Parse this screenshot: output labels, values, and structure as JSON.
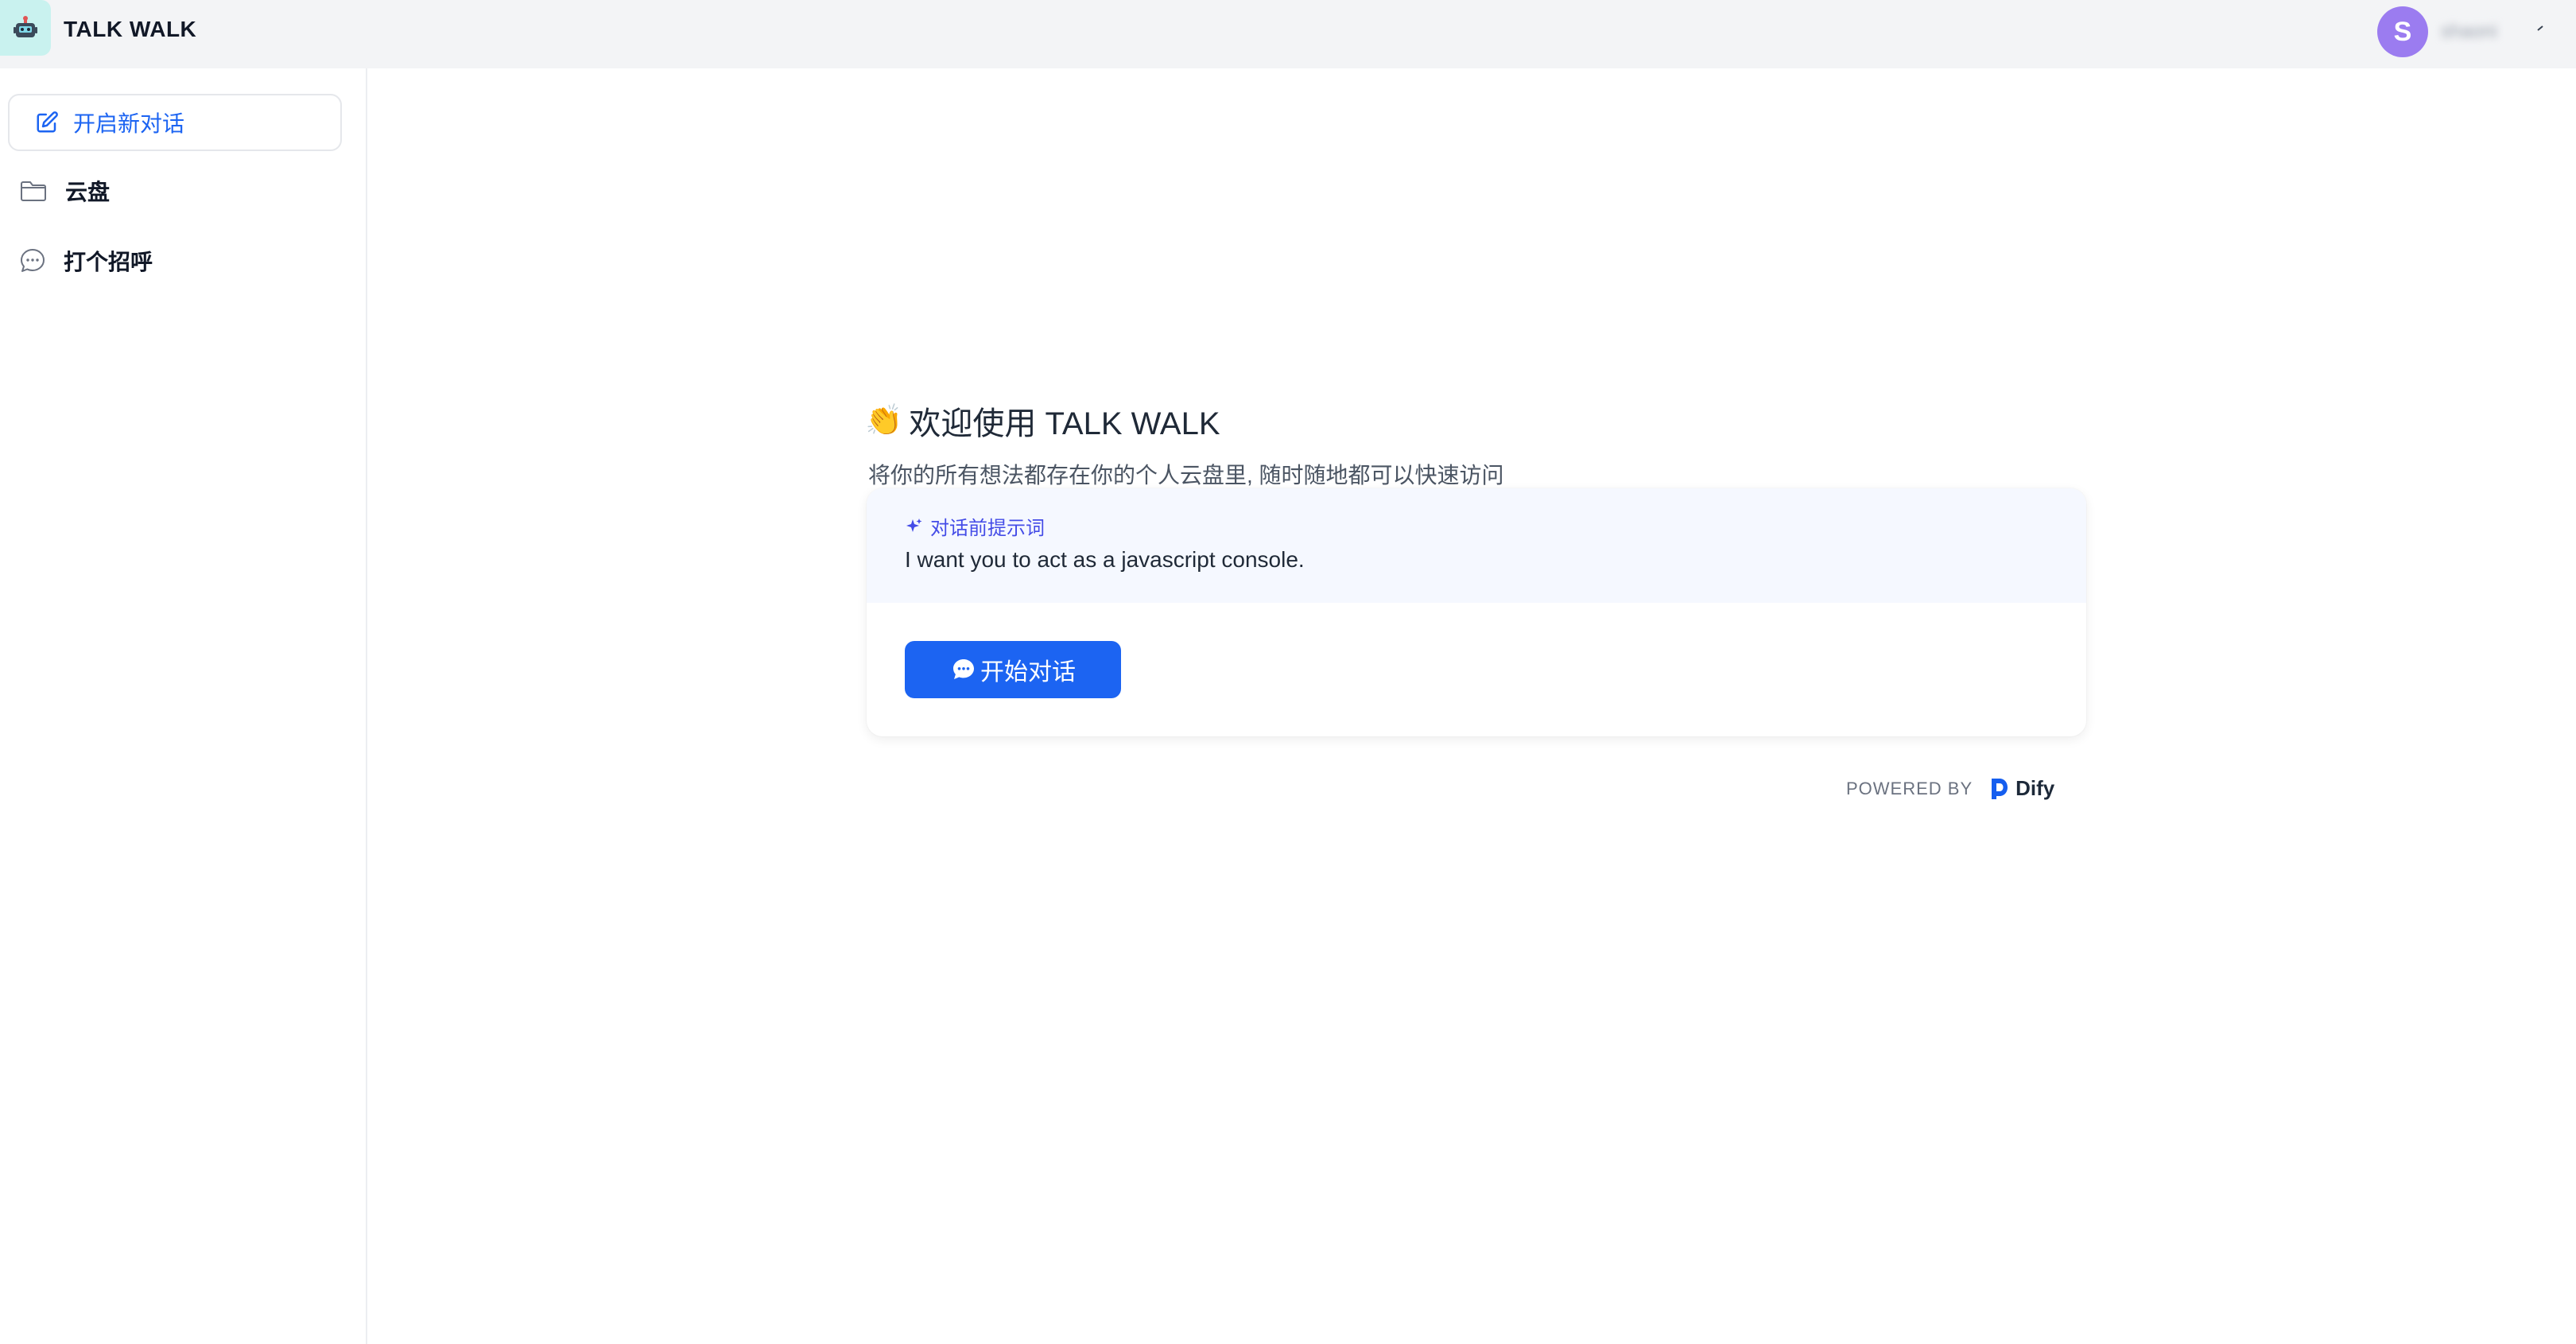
{
  "header": {
    "app_title": "TALK WALK",
    "user_initial": "S",
    "username": "shaoni"
  },
  "sidebar": {
    "new_chat_label": "开启新对话",
    "items": [
      {
        "label": "云盘",
        "icon": "folder-icon"
      },
      {
        "label": "打个招呼",
        "icon": "chat-bubble-icon"
      }
    ]
  },
  "main": {
    "welcome_emoji": "👏",
    "welcome_title": "欢迎使用 TALK WALK",
    "subtitle": "将你的所有想法都存在你的个人云盘里, 随时随地都可以快速访问",
    "prompt_heading": "对话前提示词",
    "prompt_text": "I want you to act as a javascript console.",
    "start_button": "开始对话",
    "powered_by": "POWERED BY",
    "brand": "Dify"
  },
  "colors": {
    "accent": "#1c64f2",
    "prompt_heading": "#444ce7",
    "avatar": "#9b7cf0",
    "header_bg": "#f3f4f6"
  }
}
